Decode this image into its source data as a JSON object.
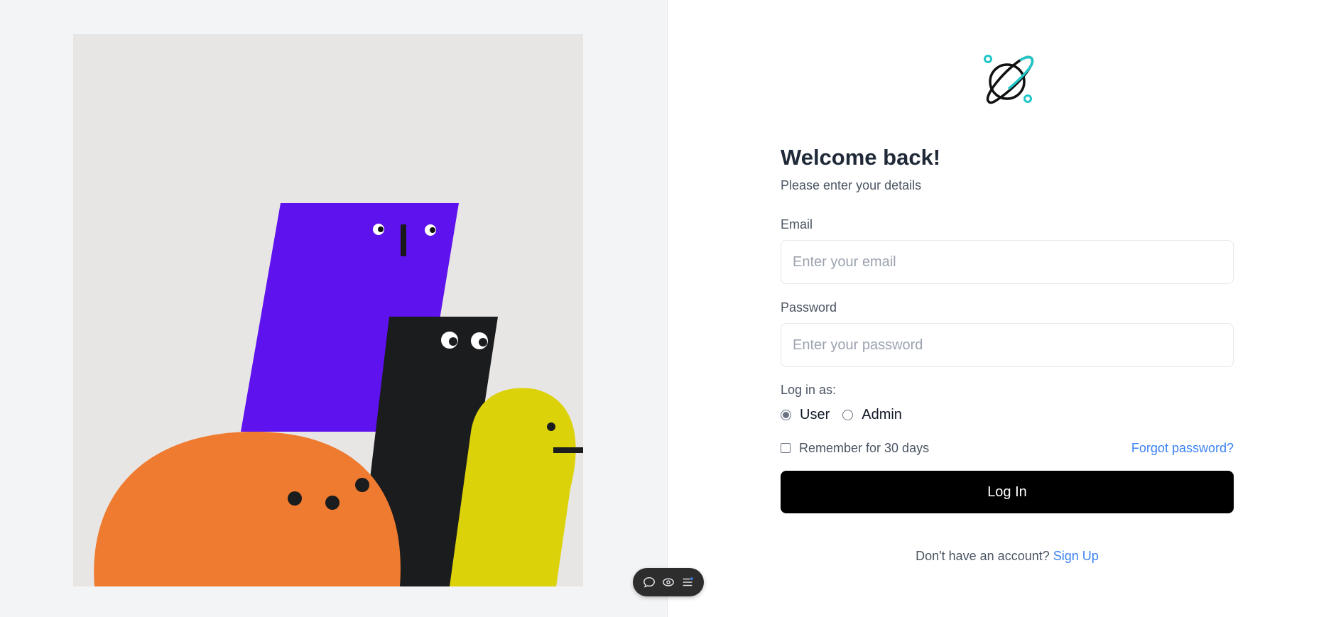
{
  "login": {
    "title": "Welcome back!",
    "subtitle": "Please enter your details",
    "email": {
      "label": "Email",
      "placeholder": "Enter your email",
      "value": ""
    },
    "password": {
      "label": "Password",
      "placeholder": "Enter your password",
      "value": ""
    },
    "role": {
      "label": "Log in as:",
      "options": [
        "User",
        "Admin"
      ],
      "selected": "User"
    },
    "remember_label": "Remember for 30 days",
    "remember_checked": false,
    "forgot_label": "Forgot password?",
    "submit_label": "Log In",
    "signup_prompt": "Don't have an account?",
    "signup_label": "Sign Up"
  },
  "colors": {
    "accent": "#22c8c8",
    "link": "#3b82f6",
    "button": "#000000",
    "left_background": "#f3f4f6"
  },
  "icons": {
    "logo": "planet-icon",
    "toolbar": [
      "comment-icon",
      "eye-icon",
      "menu-icon"
    ]
  }
}
